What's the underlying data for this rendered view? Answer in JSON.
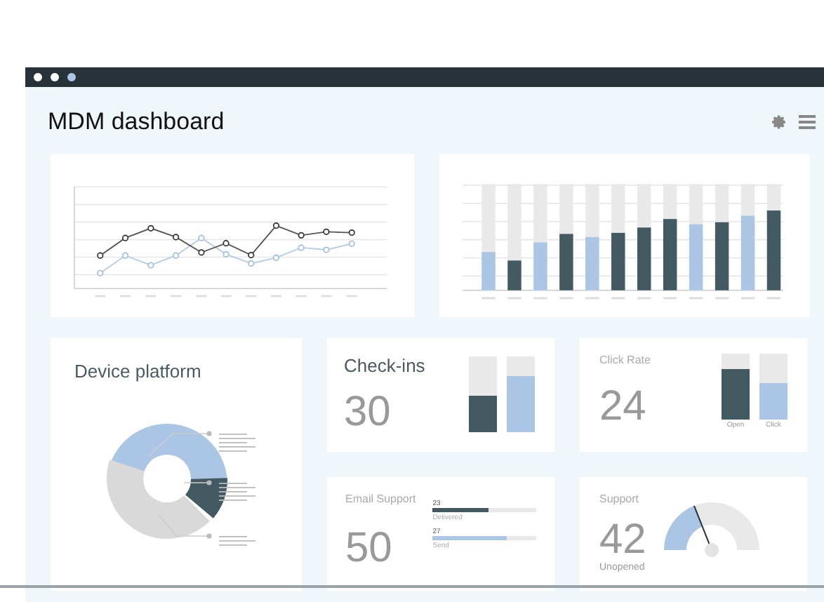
{
  "window": {
    "title": "MDM dashboard"
  },
  "device_platform": {
    "title": "Device platform"
  },
  "check_ins": {
    "title": "Check-ins",
    "value": "30",
    "bars": [
      {
        "level": 0.48,
        "color": "#435a63"
      },
      {
        "level": 0.74,
        "color": "#abc6e4"
      }
    ]
  },
  "click_rate": {
    "title": "Click Rate",
    "value": "24",
    "bars": [
      {
        "label": "Open",
        "level": 0.77,
        "color": "#435a63"
      },
      {
        "label": "Click",
        "level": 0.55,
        "color": "#abc6e4"
      }
    ]
  },
  "email_support": {
    "title": "Email Support",
    "value": "50",
    "bars": [
      {
        "value": "23",
        "label": "Delivered",
        "level": 0.54,
        "color": "#435a63"
      },
      {
        "value": "27",
        "label": "Send",
        "level": 0.72,
        "color": "#abc6e4"
      }
    ]
  },
  "support": {
    "title": "Support",
    "value": "42",
    "caption": "Unopened",
    "level": 0.38
  }
}
